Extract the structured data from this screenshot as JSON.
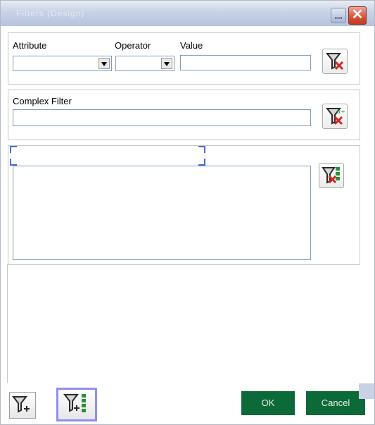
{
  "window": {
    "title": "Filters (Design)"
  },
  "simple_filter": {
    "attribute_label": "Attribute",
    "operator_label": "Operator",
    "value_label": "Value",
    "attribute_value": "",
    "operator_value": "",
    "value_value": "",
    "clear_icon": "funnel-clear-icon"
  },
  "complex_filter": {
    "label": "Complex Filter",
    "value": "",
    "clear_icon": "funnel-clear-alpha-beta-icon"
  },
  "list_filter": {
    "header_value": "",
    "list_value": "",
    "clear_icon": "funnel-clear-list-icon"
  },
  "footer": {
    "add_filter_icon": "funnel-add-icon",
    "add_list_filter_icon": "funnel-add-list-icon",
    "ok_label": "OK",
    "cancel_label": "Cancel"
  },
  "colors": {
    "ok_green": "#0b6a37",
    "selected_border": "#8e8ef2"
  }
}
